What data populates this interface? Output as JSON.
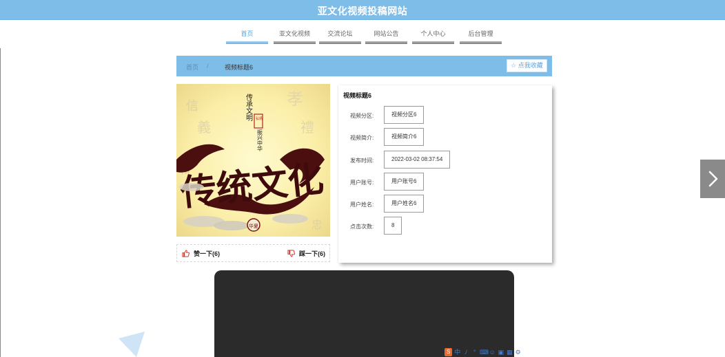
{
  "site": {
    "title": "亚文化视频投稿网站"
  },
  "nav": {
    "items": [
      {
        "label": "首页",
        "active": true
      },
      {
        "label": "亚文化视频",
        "active": false
      },
      {
        "label": "交流论坛",
        "active": false
      },
      {
        "label": "网站公告",
        "active": false
      },
      {
        "label": "个人中心",
        "active": false
      },
      {
        "label": "后台管理",
        "active": false
      }
    ]
  },
  "breadcrumb": {
    "home": "首页",
    "separator": "/",
    "current": "视频标题6"
  },
  "favorite": {
    "icon": "star-outline-icon",
    "label": "点我收藏"
  },
  "cover": {
    "calligraphy": "传统文化",
    "side_text": "传承文明",
    "side_text_2": "振兴中华",
    "seal_top": "弘扬",
    "seal_bottom": "华夏"
  },
  "votes": {
    "up": {
      "icon": "thumbs-up-icon",
      "label": "赞一下(6)"
    },
    "down": {
      "icon": "thumbs-down-icon",
      "label": "踩一下(6)"
    }
  },
  "detail": {
    "title": "视频标题6",
    "fields": [
      {
        "label": "视频分区:",
        "value": "视频分区6"
      },
      {
        "label": "视频简介:",
        "value": "视频简介6"
      },
      {
        "label": "发布时间:",
        "value": "2022-03-02 08:37:54"
      },
      {
        "label": "用户账号:",
        "value": "用户账号6"
      },
      {
        "label": "用户姓名:",
        "value": "用户姓名6"
      },
      {
        "label": "点击次数:",
        "value": "8"
      }
    ]
  },
  "slider": {
    "next_icon": "chevron-right-icon"
  },
  "ime": {
    "logo": "S",
    "mode": "中",
    "glyphs": [
      "ﾉ",
      "°",
      "⌨",
      "☺",
      "▣",
      "▦",
      "⚙"
    ]
  },
  "colors": {
    "header": "#7fbde9",
    "accent": "#5aa6e0",
    "thumbs": "#d9342b",
    "player": "#2b2b2b"
  }
}
